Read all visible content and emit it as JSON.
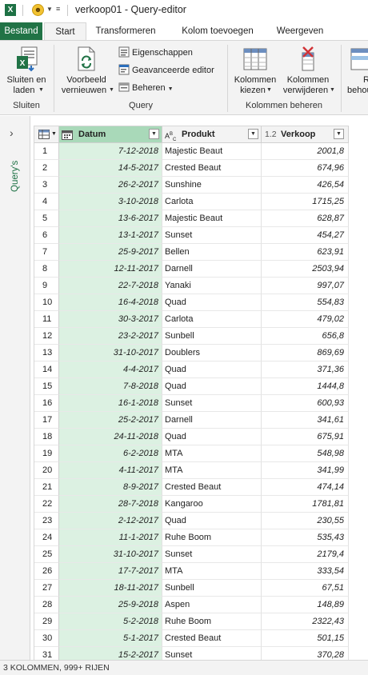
{
  "window": {
    "title": "verkoop01 - Query-editor",
    "app_icon": "X"
  },
  "tabs": [
    {
      "label": "Bestand"
    },
    {
      "label": "Start"
    },
    {
      "label": "Transformeren"
    },
    {
      "label": "Kolom toevoegen"
    },
    {
      "label": "Weergeven"
    }
  ],
  "ribbon": {
    "close_load": {
      "line1": "Sluiten en",
      "line2": "laden"
    },
    "refresh_preview": {
      "line1": "Voorbeeld",
      "line2": "vernieuwen"
    },
    "properties": "Eigenschappen",
    "advanced_editor": "Geavanceerde editor",
    "manage": "Beheren",
    "choose_columns": {
      "line1": "Kolommen",
      "line2": "kiezen"
    },
    "remove_columns": {
      "line1": "Kolommen",
      "line2": "verwijderen"
    },
    "cut_off": {
      "line1": "R",
      "line2": "behou"
    },
    "groups": {
      "close": "Sluiten",
      "query": "Query",
      "manage_columns": "Kolommen beheren"
    }
  },
  "left_pane": {
    "label": "Query's"
  },
  "grid": {
    "columns": [
      {
        "name": "Datum",
        "type_icon": "calendar-icon"
      },
      {
        "name": "Produkt",
        "type_icon": "ABC"
      },
      {
        "name": "Verkoop",
        "type_icon": "1.2"
      }
    ],
    "rows": [
      {
        "n": "1",
        "datum": "7-12-2018",
        "produkt": "Majestic Beaut",
        "verkoop": "2001,8"
      },
      {
        "n": "2",
        "datum": "14-5-2017",
        "produkt": "Crested Beaut",
        "verkoop": "674,96"
      },
      {
        "n": "3",
        "datum": "26-2-2017",
        "produkt": "Sunshine",
        "verkoop": "426,54"
      },
      {
        "n": "4",
        "datum": "3-10-2018",
        "produkt": "Carlota",
        "verkoop": "1715,25"
      },
      {
        "n": "5",
        "datum": "13-6-2017",
        "produkt": "Majestic Beaut",
        "verkoop": "628,87"
      },
      {
        "n": "6",
        "datum": "13-1-2017",
        "produkt": "Sunset",
        "verkoop": "454,27"
      },
      {
        "n": "7",
        "datum": "25-9-2017",
        "produkt": "Bellen",
        "verkoop": "623,91"
      },
      {
        "n": "8",
        "datum": "12-11-2017",
        "produkt": "Darnell",
        "verkoop": "2503,94"
      },
      {
        "n": "9",
        "datum": "22-7-2018",
        "produkt": "Yanaki",
        "verkoop": "997,07"
      },
      {
        "n": "10",
        "datum": "16-4-2018",
        "produkt": "Quad",
        "verkoop": "554,83"
      },
      {
        "n": "11",
        "datum": "30-3-2017",
        "produkt": "Carlota",
        "verkoop": "479,02"
      },
      {
        "n": "12",
        "datum": "23-2-2017",
        "produkt": "Sunbell",
        "verkoop": "656,8"
      },
      {
        "n": "13",
        "datum": "31-10-2017",
        "produkt": "Doublers",
        "verkoop": "869,69"
      },
      {
        "n": "14",
        "datum": "4-4-2017",
        "produkt": "Quad",
        "verkoop": "371,36"
      },
      {
        "n": "15",
        "datum": "7-8-2018",
        "produkt": "Quad",
        "verkoop": "1444,8"
      },
      {
        "n": "16",
        "datum": "16-1-2018",
        "produkt": "Sunset",
        "verkoop": "600,93"
      },
      {
        "n": "17",
        "datum": "25-2-2017",
        "produkt": "Darnell",
        "verkoop": "341,61"
      },
      {
        "n": "18",
        "datum": "24-11-2018",
        "produkt": "Quad",
        "verkoop": "675,91"
      },
      {
        "n": "19",
        "datum": "6-2-2018",
        "produkt": "MTA",
        "verkoop": "548,98"
      },
      {
        "n": "20",
        "datum": "4-11-2017",
        "produkt": "MTA",
        "verkoop": "341,99"
      },
      {
        "n": "21",
        "datum": "8-9-2017",
        "produkt": "Crested Beaut",
        "verkoop": "474,14"
      },
      {
        "n": "22",
        "datum": "28-7-2018",
        "produkt": "Kangaroo",
        "verkoop": "1781,81"
      },
      {
        "n": "23",
        "datum": "2-12-2017",
        "produkt": "Quad",
        "verkoop": "230,55"
      },
      {
        "n": "24",
        "datum": "11-1-2017",
        "produkt": "Ruhe Boom",
        "verkoop": "535,43"
      },
      {
        "n": "25",
        "datum": "31-10-2017",
        "produkt": "Sunset",
        "verkoop": "2179,4"
      },
      {
        "n": "26",
        "datum": "17-7-2017",
        "produkt": "MTA",
        "verkoop": "333,54"
      },
      {
        "n": "27",
        "datum": "18-11-2017",
        "produkt": "Sunbell",
        "verkoop": "67,51"
      },
      {
        "n": "28",
        "datum": "25-9-2018",
        "produkt": "Aspen",
        "verkoop": "148,89"
      },
      {
        "n": "29",
        "datum": "5-2-2018",
        "produkt": "Ruhe Boom",
        "verkoop": "2322,43"
      },
      {
        "n": "30",
        "datum": "5-1-2017",
        "produkt": "Crested Beaut",
        "verkoop": "501,15"
      },
      {
        "n": "31",
        "datum": "15-2-2017",
        "produkt": "Sunset",
        "verkoop": "370,28"
      }
    ]
  },
  "status": {
    "text": "3 KOLOMMEN, 999+ RIJEN"
  },
  "colors": {
    "excel_green": "#217346",
    "date_col_bg": "#dcf1e2",
    "date_header_bg": "#a9d9b9"
  }
}
